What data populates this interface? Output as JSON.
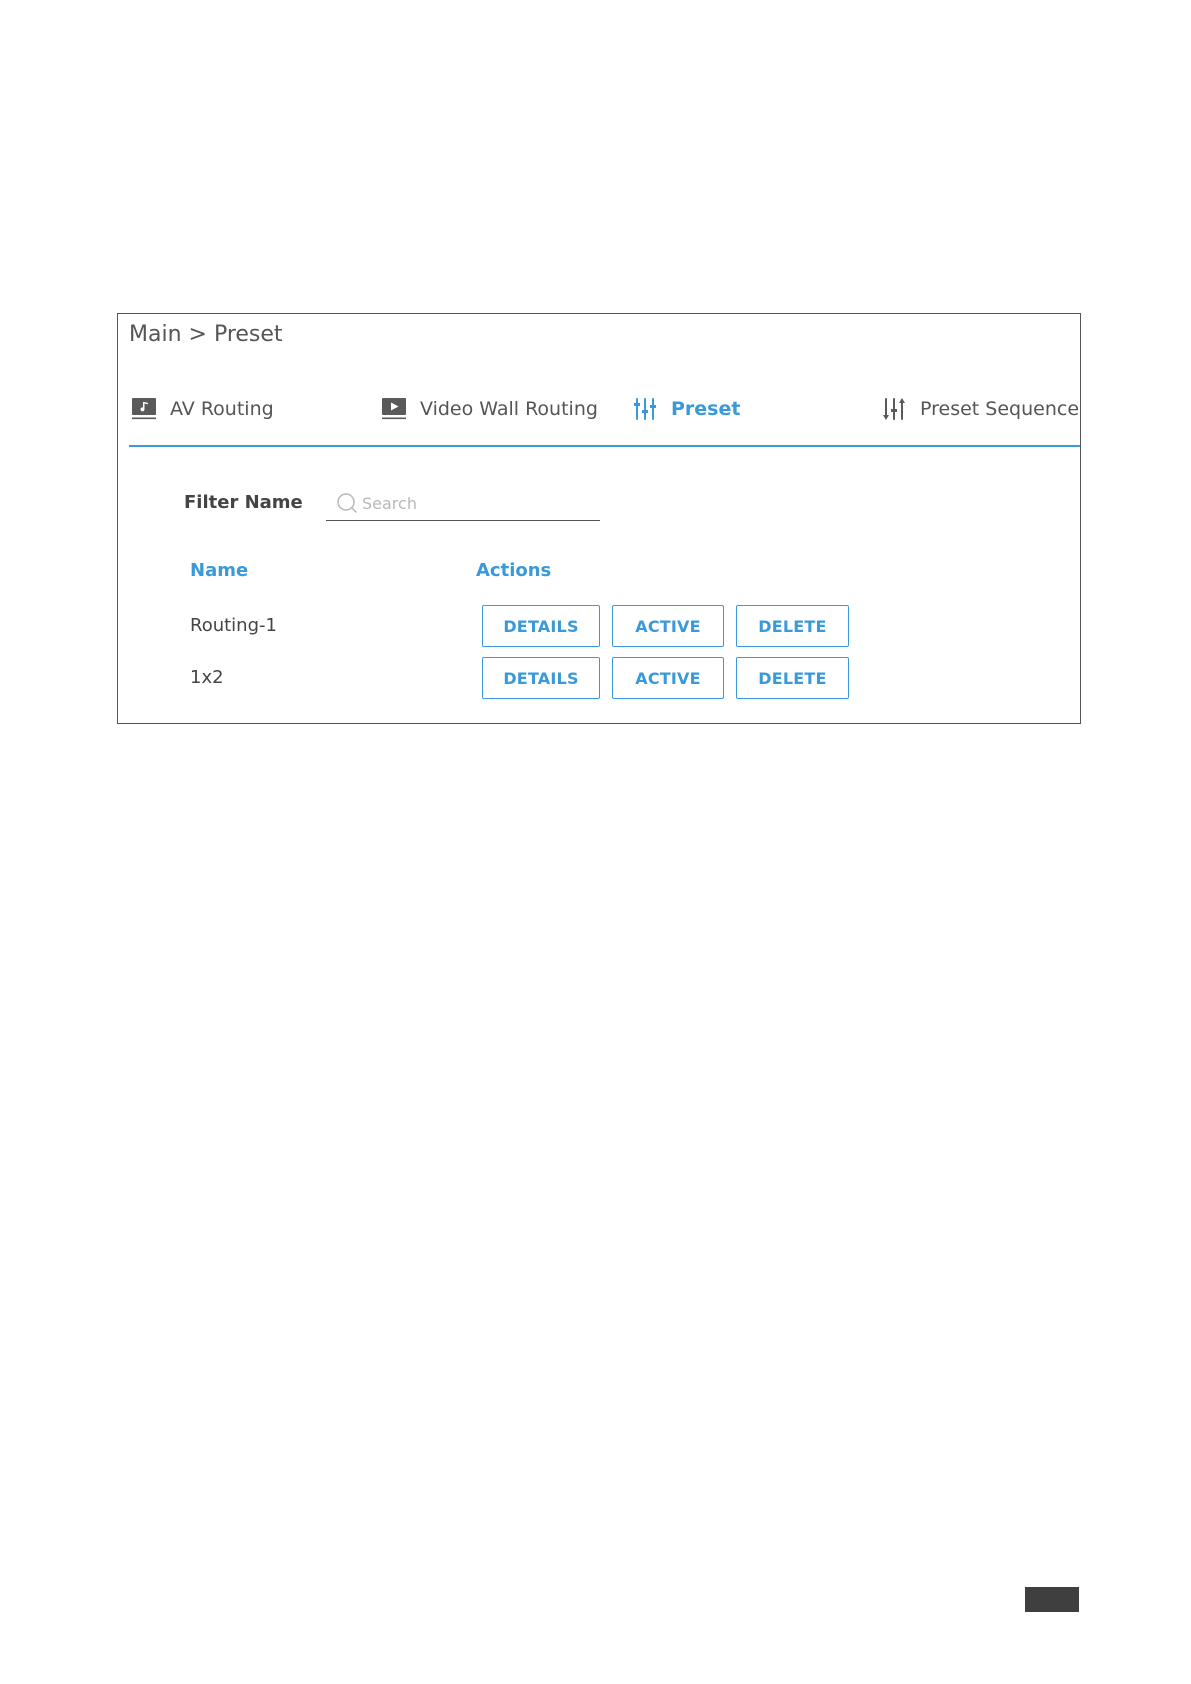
{
  "breadcrumb": "Main > Preset",
  "tabs": [
    {
      "label": "AV Routing",
      "icon": "av-routing-icon",
      "active": false
    },
    {
      "label": "Video Wall Routing",
      "icon": "video-wall-icon",
      "active": false
    },
    {
      "label": "Preset",
      "icon": "sliders-icon",
      "active": true
    },
    {
      "label": "Preset Sequence",
      "icon": "sequence-sliders-icon",
      "active": false
    }
  ],
  "filter": {
    "label": "Filter Name",
    "placeholder": "Search",
    "value": ""
  },
  "table": {
    "headers": {
      "name": "Name",
      "actions": "Actions"
    },
    "rows": [
      {
        "name": "Routing-1",
        "actions": [
          "DETAILS",
          "ACTIVE",
          "DELETE"
        ]
      },
      {
        "name": "1x2",
        "actions": [
          "DETAILS",
          "ACTIVE",
          "DELETE"
        ]
      }
    ]
  },
  "colors": {
    "accent": "#3a9ad9",
    "text": "#444444",
    "border": "#555555",
    "placeholder": "#b8b8b8"
  }
}
